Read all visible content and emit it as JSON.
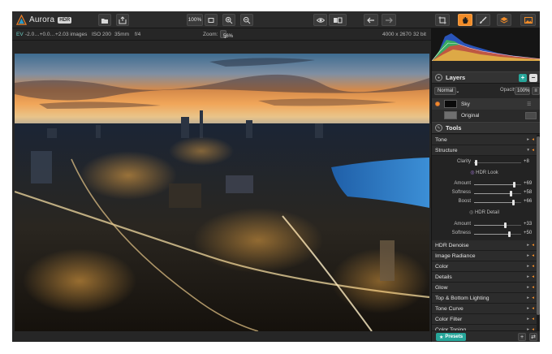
{
  "app": {
    "name": "Aurora",
    "edition": "HDR"
  },
  "toolbar": {
    "zoom_percent": "100%"
  },
  "infobar": {
    "ev_label": "EV",
    "ev_values": "-2.0…+0.0…+2.0",
    "images": "3 images",
    "iso": "ISO 200",
    "focal": "35mm",
    "aperture": "f/4",
    "zoom_label": "Zoom:",
    "zoom_value": "56%",
    "dimensions": "4000 x 2670",
    "bit_depth": "32 bit"
  },
  "layers": {
    "title": "Layers",
    "blend_mode": "Normal",
    "opacity_label": "Opacity:",
    "opacity_value": "100%",
    "items": [
      {
        "name": "Sky"
      },
      {
        "name": "Original"
      }
    ]
  },
  "tools": {
    "title": "Tools",
    "tone_label": "Tone",
    "structure_label": "Structure",
    "clarity": {
      "label": "Clarity",
      "value": "+8",
      "fraction": 0.04
    },
    "hdr_look": {
      "title": "HDR Look",
      "amount": {
        "label": "Amount",
        "value": "+69",
        "fraction": 0.85
      },
      "softness": {
        "label": "Softness",
        "value": "+58",
        "fraction": 0.79
      },
      "boost": {
        "label": "Boost",
        "value": "+66",
        "fraction": 0.83
      }
    },
    "hdr_detail": {
      "title": "HDR Detail",
      "amount": {
        "label": "Amount",
        "value": "+33",
        "fraction": 0.66
      },
      "softness": {
        "label": "Softness",
        "value": "+50",
        "fraction": 0.75
      }
    },
    "sections": [
      "HDR Denoise",
      "Image Radiance",
      "Color",
      "Details",
      "Glow",
      "Top & Bottom Lighting",
      "Tone Curve",
      "Color Filter",
      "Color Toning"
    ]
  },
  "bottom": {
    "presets_label": "Presets"
  },
  "colors": {
    "accent_orange": "#f28c28",
    "accent_teal": "#27a69a",
    "panel_bg": "#262626"
  },
  "icons": {
    "toolbar": [
      "folder-icon",
      "export-icon",
      "fit-screen-icon",
      "zoom-in-icon",
      "zoom-out-icon",
      "eye-icon",
      "compare-icon",
      "undo-icon",
      "redo-icon",
      "crop-icon",
      "hand-icon",
      "brush-icon",
      "layers-icon",
      "image-icon"
    ]
  }
}
